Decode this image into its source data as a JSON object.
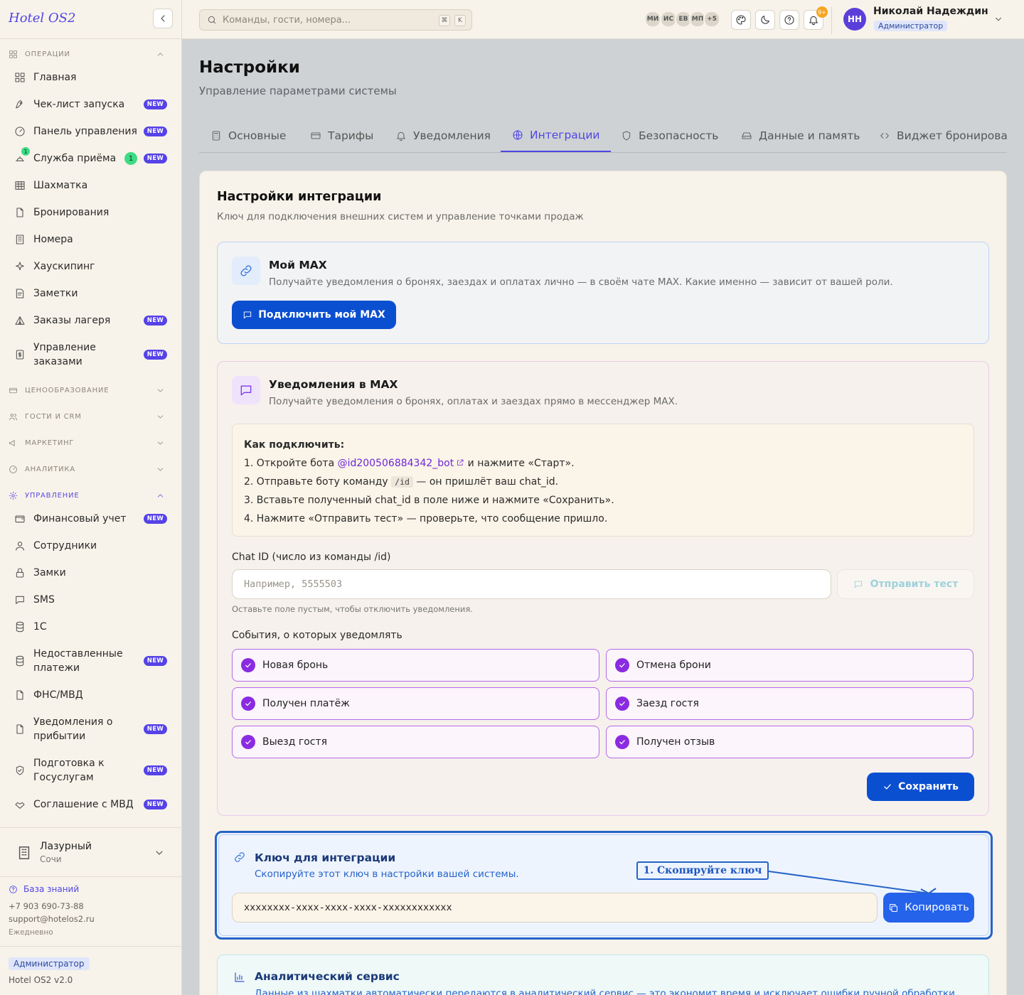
{
  "app": {
    "logo": "Hotel OS2",
    "version": "Hotel OS2 v2.0"
  },
  "colors": {
    "accent": "#4f46e5",
    "primary_button": "#0b4fd1",
    "badge_new": "#5542e8",
    "badge_count": "#3ddc84",
    "checkbox": "#8a2be2"
  },
  "sidebar": {
    "sections": {
      "operations": "Операции",
      "pricing": "Ценообразование",
      "guests": "Гости и CRM",
      "marketing": "Маркетинг",
      "analytics": "Аналитика",
      "management": "Управление"
    },
    "ops_items": [
      {
        "label": "Главная",
        "icon": "grid-icon"
      },
      {
        "label": "Чек-лист запуска",
        "icon": "rocket-icon",
        "badge": "NEW"
      },
      {
        "label": "Панель управления",
        "icon": "gauge-icon",
        "badge": "NEW"
      },
      {
        "label": "Служба приёма",
        "icon": "bell-desk-icon",
        "badge": "NEW",
        "count": "1"
      },
      {
        "label": "Шахматка",
        "icon": "table-icon"
      },
      {
        "label": "Бронирования",
        "icon": "file-icon"
      },
      {
        "label": "Номера",
        "icon": "building-icon"
      },
      {
        "label": "Хаускипинг",
        "icon": "sparkle-icon"
      },
      {
        "label": "Заметки",
        "icon": "note-icon"
      },
      {
        "label": "Заказы лагеря",
        "icon": "tent-icon",
        "badge": "NEW"
      },
      {
        "label": "Управление заказами",
        "icon": "dollar-file-icon",
        "badge": "NEW"
      }
    ],
    "mgmt_items": [
      {
        "label": "Финансовый учет",
        "icon": "wallet-icon",
        "badge": "NEW"
      },
      {
        "label": "Сотрудники",
        "icon": "user-icon"
      },
      {
        "label": "Замки",
        "icon": "lock-icon"
      },
      {
        "label": "SMS",
        "icon": "message-icon"
      },
      {
        "label": "1С",
        "icon": "database-icon"
      },
      {
        "label": "Недоставленные платежи",
        "icon": "database-icon",
        "badge": "NEW"
      },
      {
        "label": "ФНС/МВД",
        "icon": "file-icon"
      },
      {
        "label": "Уведомления о прибытии",
        "icon": "file-icon",
        "badge": "NEW"
      },
      {
        "label": "Подготовка к Госуслугам",
        "icon": "shield-check-icon",
        "badge": "NEW"
      },
      {
        "label": "Соглашение с МВД",
        "icon": "handshake-icon",
        "badge": "NEW"
      }
    ],
    "hotel": {
      "name": "Лазурный",
      "city": "Сочи"
    },
    "kb_label": "База знаний",
    "phone": "+7 903 690-73-88",
    "email": "support@hotelos2.ru",
    "hours": "Ежедневно",
    "role": "Администратор"
  },
  "topbar": {
    "search_placeholder": "Команды, гости, номера...",
    "kbd1": "⌘",
    "kbd2": "K",
    "avatars": [
      "МИ",
      "ИС",
      "ЕВ",
      "МП",
      "+5"
    ],
    "notif_count": "9+",
    "user_initials": "НН",
    "user_name": "Николай Надеждин",
    "user_role": "Администратор"
  },
  "page": {
    "title": "Настройки",
    "subtitle": "Управление параметрами системы"
  },
  "tabs": [
    {
      "label": "Основные",
      "icon": "calculator-icon"
    },
    {
      "label": "Тарифы",
      "icon": "card-icon"
    },
    {
      "label": "Уведомления",
      "icon": "bell-icon"
    },
    {
      "label": "Интеграции",
      "icon": "globe-icon",
      "active": true
    },
    {
      "label": "Безопасность",
      "icon": "shield-icon"
    },
    {
      "label": "Данные и память",
      "icon": "drive-icon"
    },
    {
      "label": "Виджет бронирова",
      "icon": "code-icon"
    }
  ],
  "integration": {
    "title": "Настройки интеграции",
    "subtitle": "Ключ для подключения внешних систем и управление точками продаж",
    "my_max": {
      "title": "Мой MAX",
      "subtitle": "Получайте уведомления о бронях, заездах и оплатах лично — в своём чате MAX. Какие именно — зависит от вашей роли.",
      "button": "Подключить мой MAX"
    },
    "max_notif": {
      "title": "Уведомления в MAX",
      "subtitle": "Получайте уведомления о бронях, оплатах и заездах прямо в мессенджер MAX.",
      "howto_title": "Как подключить:",
      "step1_a": "1. Откройте бота ",
      "step1_link": "@id200506884342_bot",
      "step1_b": " и нажмите «Старт».",
      "step2_a": "2. Отправьте боту команду ",
      "step2_code": "/id",
      "step2_b": " — он пришлёт ваш chat_id.",
      "step3": "3. Вставьте полученный chat_id в поле ниже и нажмите «Сохранить».",
      "step4": "4. Нажмите «Отправить тест» — проверьте, что сообщение пришло.",
      "chat_label": "Chat ID (число из команды /id)",
      "chat_placeholder": "Например, 5555503",
      "test_button": "Отправить тест",
      "hint": "Оставьте поле пустым, чтобы отключить уведомления.",
      "events_label": "События, о которых уведомлять",
      "events": [
        {
          "label": "Новая бронь",
          "checked": true
        },
        {
          "label": "Отмена брони",
          "checked": true
        },
        {
          "label": "Получен платёж",
          "checked": true
        },
        {
          "label": "Заезд гостя",
          "checked": true
        },
        {
          "label": "Выезд гостя",
          "checked": true
        },
        {
          "label": "Получен отзыв",
          "checked": true
        }
      ],
      "save_button": "Сохранить"
    },
    "key": {
      "title": "Ключ для интеграции",
      "subtitle": "Скопируйте этот ключ в настройки вашей системы.",
      "value": "xxxxxxxx-xxxx-xxxx-xxxx-xxxxxxxxxxxx",
      "copy_button": "Копировать",
      "annotation": "1. Скопируйте ключ"
    },
    "analytics": {
      "title": "Аналитический сервис",
      "subtitle": "Данные из шахматки автоматически передаются в аналитический сервис — это экономит время и исключает ошибки ручной обработки."
    }
  }
}
